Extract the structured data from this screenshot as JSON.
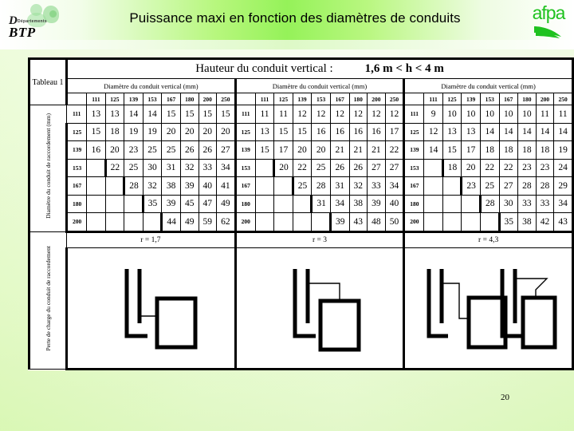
{
  "header": {
    "title": "Puissance maxi en fonction des diamètres de conduits",
    "logo_left_letter": "D",
    "logo_left_sub": "Départements",
    "logo_left_name": "BTP",
    "logo_right_name": "afpa"
  },
  "table": {
    "corner_label": "Tableau 1",
    "top_header_label": "Hauteur du conduit vertical :",
    "top_header_value": "1,6 m < h < 4 m",
    "group_header": "Diamètre du conduit vertical (mm)",
    "row_axis_label": "Diamètre du conduit de raccordement (mm)",
    "diagram_axis_label": "Perte de charge du conduit de raccordement",
    "columns": [
      "111",
      "125",
      "139",
      "153",
      "167",
      "180",
      "200",
      "250"
    ],
    "rows": [
      "111",
      "125",
      "139",
      "153",
      "167",
      "180",
      "200"
    ],
    "blocks": [
      {
        "r_label": "r = 1,7",
        "values": [
          [
            "13",
            "13",
            "14",
            "14",
            "15",
            "15",
            "15",
            "15"
          ],
          [
            "15",
            "18",
            "19",
            "19",
            "20",
            "20",
            "20",
            "20"
          ],
          [
            "16",
            "20",
            "23",
            "25",
            "25",
            "26",
            "26",
            "27"
          ],
          [
            "",
            "22",
            "25",
            "30",
            "31",
            "32",
            "33",
            "34"
          ],
          [
            "",
            "",
            "28",
            "32",
            "38",
            "39",
            "40",
            "41"
          ],
          [
            "",
            "",
            "",
            "35",
            "39",
            "45",
            "47",
            "49"
          ],
          [
            "",
            "",
            "",
            "",
            "44",
            "49",
            "59",
            "62"
          ]
        ],
        "diagram": "single-tee"
      },
      {
        "r_label": "r = 3",
        "values": [
          [
            "11",
            "11",
            "12",
            "12",
            "12",
            "12",
            "12",
            "12"
          ],
          [
            "13",
            "15",
            "15",
            "16",
            "16",
            "16",
            "16",
            "17"
          ],
          [
            "15",
            "17",
            "20",
            "20",
            "21",
            "21",
            "21",
            "22"
          ],
          [
            "",
            "20",
            "22",
            "25",
            "26",
            "26",
            "27",
            "27"
          ],
          [
            "",
            "",
            "25",
            "28",
            "31",
            "32",
            "33",
            "34"
          ],
          [
            "",
            "",
            "",
            "31",
            "34",
            "38",
            "39",
            "40"
          ],
          [
            "",
            "",
            "",
            "",
            "39",
            "43",
            "48",
            "50"
          ]
        ],
        "diagram": "offset-tee"
      },
      {
        "r_label": "r = 4,3",
        "values": [
          [
            "9",
            "10",
            "10",
            "10",
            "10",
            "10",
            "11",
            "11"
          ],
          [
            "12",
            "13",
            "13",
            "14",
            "14",
            "14",
            "14",
            "14"
          ],
          [
            "14",
            "15",
            "17",
            "18",
            "18",
            "18",
            "18",
            "19"
          ],
          [
            "",
            "18",
            "20",
            "22",
            "22",
            "23",
            "23",
            "24"
          ],
          [
            "",
            "",
            "23",
            "25",
            "27",
            "28",
            "28",
            "29"
          ],
          [
            "",
            "",
            "",
            "28",
            "30",
            "33",
            "33",
            "34"
          ],
          [
            "",
            "",
            "",
            "",
            "35",
            "38",
            "42",
            "43"
          ]
        ],
        "diagram": "double"
      }
    ]
  },
  "footer": {
    "page_number": "20"
  }
}
